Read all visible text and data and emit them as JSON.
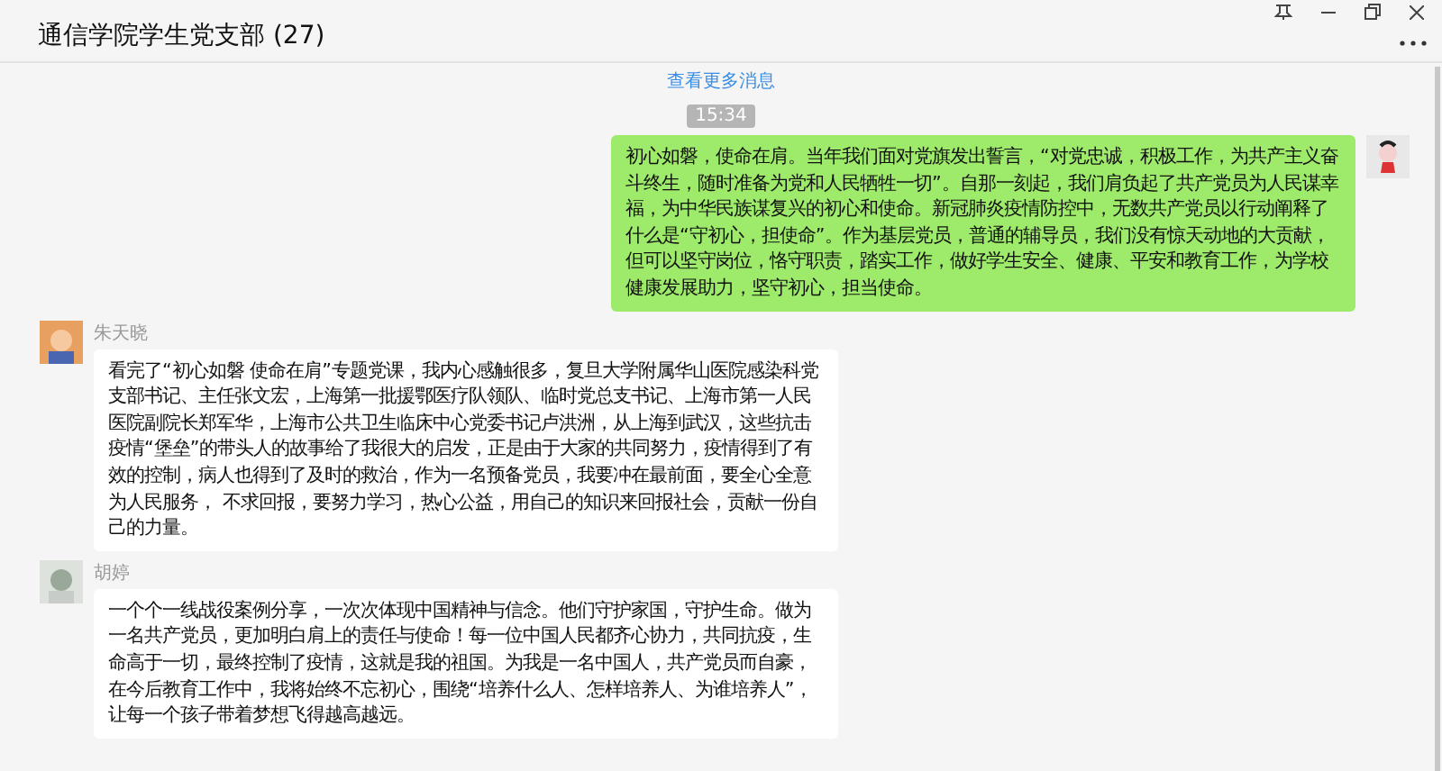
{
  "window": {
    "title": "通信学院学生党支部 (27)"
  },
  "more_messages_link": "查看更多消息",
  "timestamp": "15:34",
  "messages": [
    {
      "kind": "self",
      "text": "初心如磐，使命在肩。当年我们面对党旗发出誓言，“对党忠诚，积极工作，为共产主义奋斗终生，随时准备为党和人民牺牲一切”。自那一刻起，我们肩负起了共产党员为人民谋幸福，为中华民族谋复兴的初心和使命。新冠肺炎疫情防控中，无数共产党员以行动阐释了什么是“守初心，担使命”。作为基层党员，普通的辅导员，我们没有惊天动地的大贡献，但可以坚守岗位，恪守职责，踏实工作，做好学生安全、健康、平安和教育工作，为学校健康发展助力，坚守初心，担当使命。"
    },
    {
      "kind": "other",
      "sender": "朱天晓",
      "text": "看完了“初心如磐 使命在肩”专题党课，我内心感触很多，复旦大学附属华山医院感染科党支部书记、主任张文宏，上海第一批援鄂医疗队领队、临时党总支书记、上海市第一人民医院副院长郑军华，上海市公共卫生临床中心党委书记卢洪洲，从上海到武汉，这些抗击疫情“堡垒”的带头人的故事给了我很大的启发，正是由于大家的共同努力，疫情得到了有效的控制，病人也得到了及时的救治，作为一名预备党员，我要冲在最前面，要全心全意为人民服务， 不求回报，要努力学习，热心公益，用自己的知识来回报社会，贡献一份自己的力量。"
    },
    {
      "kind": "other",
      "sender": "胡婷",
      "text": "一个个一线战役案例分享，一次次体现中国精神与信念。他们守护家国，守护生命。做为一名共产党员，更加明白肩上的责任与使命！每一位中国人民都齐心协力，共同抗疫，生命高于一切，最终控制了疫情，这就是我的祖国。为我是一名中国人，共产党员而自豪，在今后教育工作中，我将始终不忘初心，围绕“培养什么人、怎样培养人、为谁培养人”，让每一个孩子带着梦想飞得越高越远。"
    }
  ]
}
